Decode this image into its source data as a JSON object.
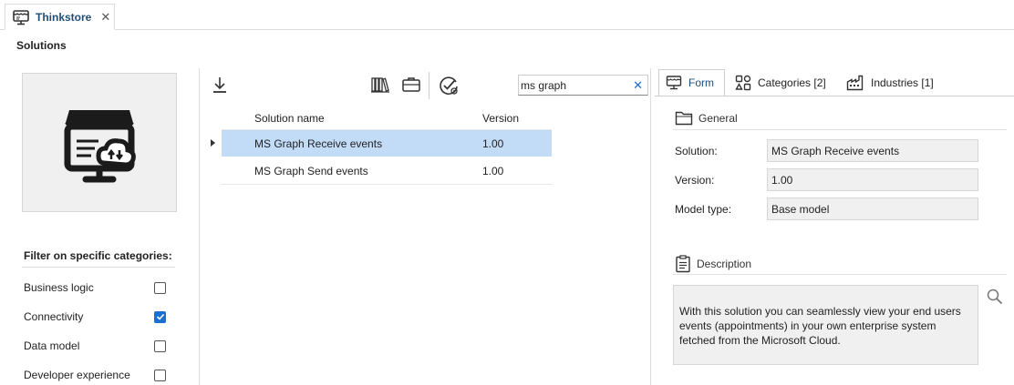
{
  "doc_tab": {
    "label": "Thinkstore",
    "close": "✕"
  },
  "page_title": "Solutions",
  "filter": {
    "title": "Filter on specific categories:",
    "items": [
      {
        "label": "Business logic",
        "checked": false
      },
      {
        "label": "Connectivity",
        "checked": true
      },
      {
        "label": "Data model",
        "checked": false
      },
      {
        "label": "Developer experience",
        "checked": false
      }
    ]
  },
  "toolbar": {
    "icons": [
      "download-icon",
      "library-icon",
      "briefcase-icon",
      "verify-gear-icon"
    ]
  },
  "search": {
    "value": "ms graph",
    "clear": "✕"
  },
  "grid": {
    "columns": [
      "Solution name",
      "Version"
    ],
    "rows": [
      {
        "name": "MS Graph Receive events",
        "version": "1.00",
        "selected": true
      },
      {
        "name": "MS Graph Send events",
        "version": "1.00",
        "selected": false
      }
    ]
  },
  "detail_tabs": [
    {
      "label": "Form",
      "icon": "form-icon",
      "active": true
    },
    {
      "label": "Categories [2]",
      "icon": "categories-icon",
      "active": false
    },
    {
      "label": "Industries [1]",
      "icon": "industries-icon",
      "active": false
    }
  ],
  "general": {
    "title": "General",
    "fields": [
      {
        "label": "Solution:",
        "value": "MS Graph Receive events"
      },
      {
        "label": "Version:",
        "value": "1.00"
      },
      {
        "label": "Model type:",
        "value": "Base model"
      }
    ]
  },
  "description": {
    "title": "Description",
    "text": "With this solution you can seamlessly view your end users events (appointments) in your own enterprise system fetched from the Microsoft Cloud."
  },
  "colors": {
    "accent": "#1a6fd1",
    "selected_row": "#c2dcf7",
    "tab_text": "#1f4e79",
    "panel_bg": "#f0f0f0"
  }
}
